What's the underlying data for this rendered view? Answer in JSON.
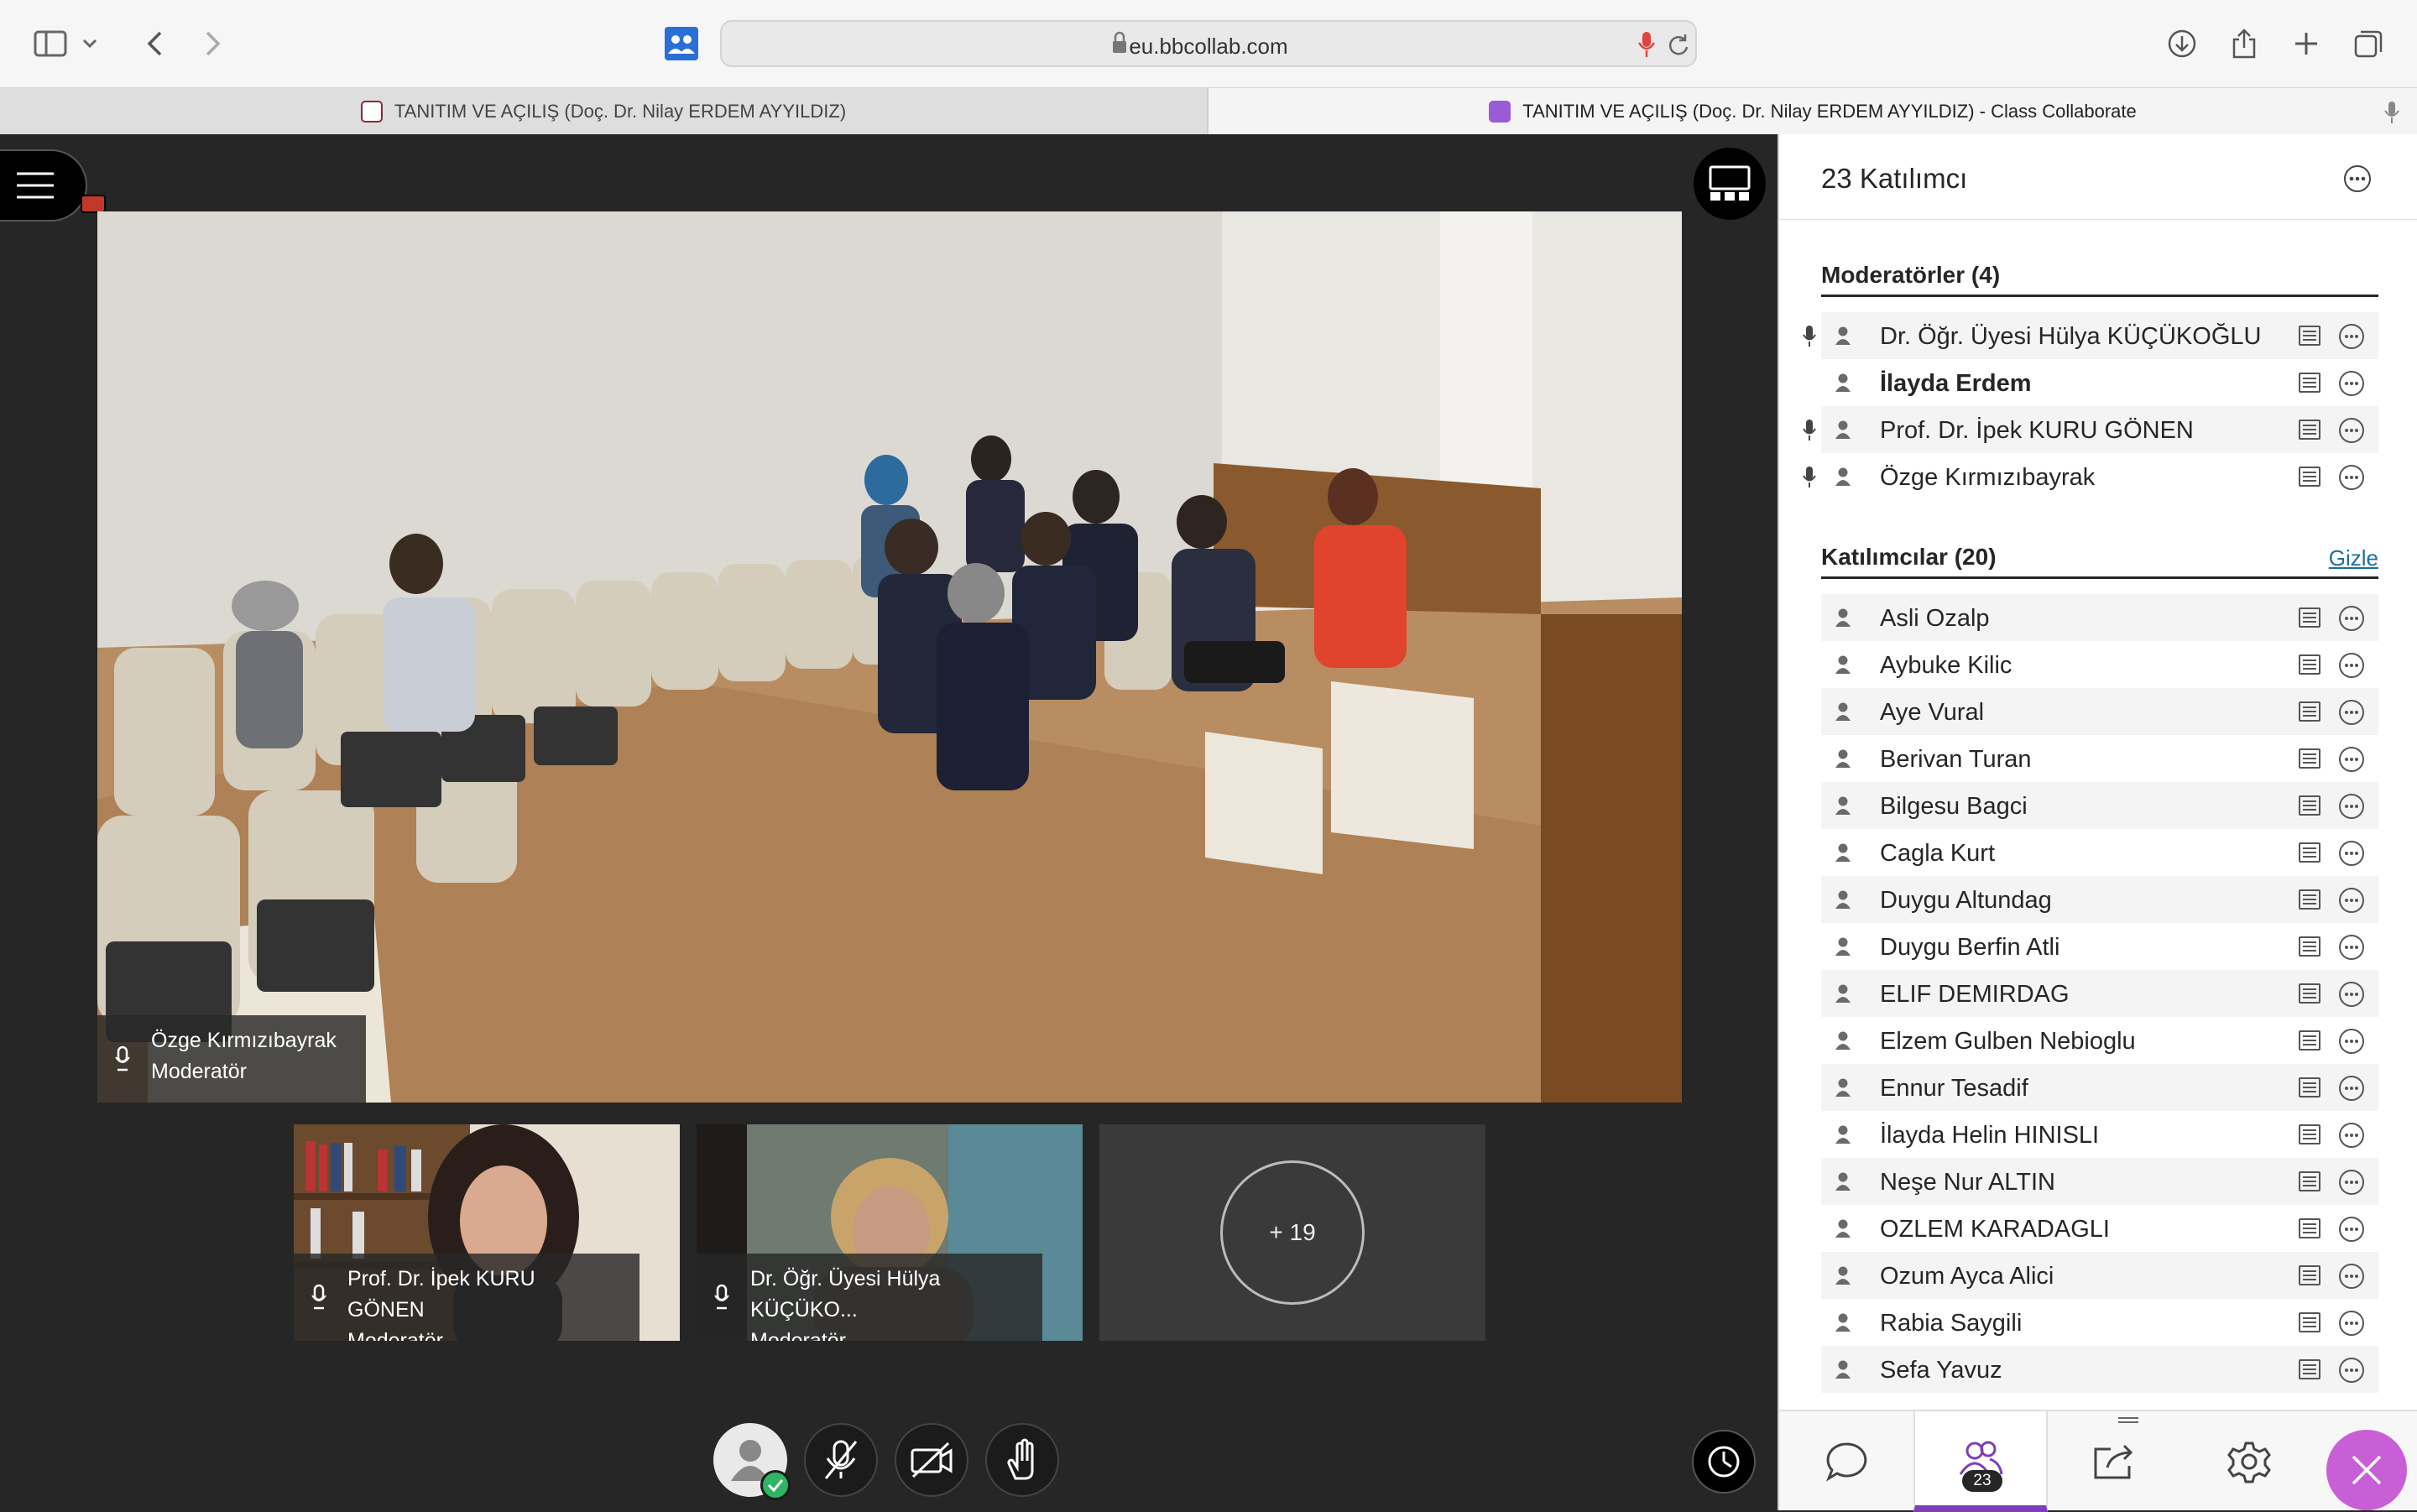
{
  "browser": {
    "address": "eu.bbcollab.com",
    "tabs": [
      {
        "label": "TANITIM VE AÇILIŞ (Doç. Dr. Nilay ERDEM AYYILDIZ)",
        "favicon_color": "#8a2a3a"
      },
      {
        "label": "TANITIM VE AÇILIŞ (Doç. Dr. Nilay ERDEM AYYILDIZ) - Class Collaborate",
        "favicon_color": "#9a5bd6"
      }
    ]
  },
  "stage": {
    "main_speaker": {
      "name": "Özge Kırmızıbayrak",
      "role": "Moderatör"
    },
    "thumbnails": [
      {
        "name": "Prof. Dr. İpek KURU GÖNEN",
        "role": "Moderatör"
      },
      {
        "name": "Dr. Öğr. Üyesi Hülya KÜÇÜKO...",
        "role": "Moderatör"
      }
    ],
    "more_count": "+ 19"
  },
  "panel": {
    "title": "23 Katılımcı",
    "moderators_heading": "Moderatörler (4)",
    "participants_heading": "Katılımcılar (20)",
    "hide_label": "Gizle",
    "moderators": [
      {
        "name": "Dr. Öğr. Üyesi Hülya KÜÇÜKOĞLU",
        "mic": true,
        "bold": false
      },
      {
        "name": "İlayda Erdem",
        "mic": false,
        "bold": true
      },
      {
        "name": "Prof. Dr. İpek KURU GÖNEN",
        "mic": true,
        "bold": false
      },
      {
        "name": "Özge Kırmızıbayrak",
        "mic": true,
        "bold": false
      }
    ],
    "participants": [
      "Asli Ozalp",
      "Aybuke Kilic",
      "Aye Vural",
      "Berivan Turan",
      "Bilgesu Bagci",
      "Cagla Kurt",
      "Duygu Altundag",
      "Duygu Berfin Atli",
      "ELIF DEMIRDAG",
      "Elzem Gulben Nebioglu",
      "Ennur Tesadif",
      "İlayda Helin HINISLI",
      "Neşe Nur ALTIN",
      "OZLEM KARADAGLI",
      "Ozum Ayca Alici",
      "Rabia Saygili",
      "Sefa Yavuz"
    ],
    "attendee_badge": "23"
  },
  "colors": {
    "accent": "#7b3fb8",
    "close": "#c85fd6",
    "link": "#1a6fa3",
    "status_ok": "#2fb463"
  },
  "icons": [
    "sidebar-icon",
    "chevron-down-icon",
    "back-icon",
    "forward-icon",
    "collab-icon",
    "lock-icon",
    "mic-icon",
    "reload-icon",
    "download-icon",
    "share-icon",
    "new-tab-icon",
    "tab-overview-icon",
    "menu-icon",
    "layout-icon",
    "person-icon",
    "caption-icon",
    "more-icon",
    "chat-icon",
    "attendees-icon",
    "share-content-icon",
    "settings-icon",
    "close-icon",
    "mic-off-icon",
    "camera-off-icon",
    "raise-hand-icon",
    "session-icon"
  ]
}
